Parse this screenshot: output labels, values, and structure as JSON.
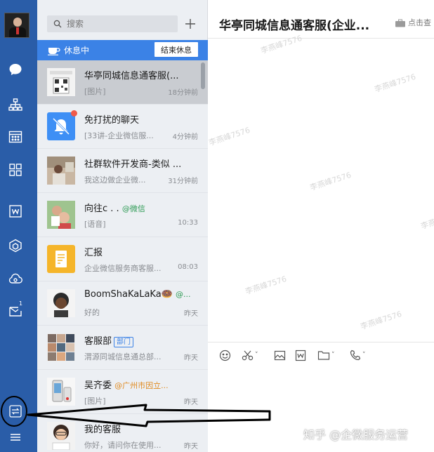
{
  "sidebar": {
    "badge_count": "1"
  },
  "search": {
    "placeholder": "搜索"
  },
  "status_bar": {
    "label": "休息中",
    "end_button": "结束休息"
  },
  "conversations": [
    {
      "name": "华亭同城信息通客服(...",
      "preview": "[图片]",
      "time": "18分钟前",
      "tag": "",
      "active": true
    },
    {
      "name": "免打扰的聊天",
      "preview": "[33讲-企业微信服...",
      "time": "4分钟前",
      "tag": "",
      "active": false
    },
    {
      "name": "社群软件开发商-类似 ...",
      "preview": "我这边做企业微...",
      "time": "31分钟前",
      "tag": "",
      "active": false
    },
    {
      "name": "向往c . .",
      "preview": "[语音]",
      "time": "10:33",
      "tag": "@微信",
      "active": false
    },
    {
      "name": "汇报",
      "preview": "企业微信服务商客服...",
      "time": "08:03",
      "tag": "",
      "active": false
    },
    {
      "name": "BoomShaKaLaKa🍩",
      "preview": "好的",
      "time": "昨天",
      "tag": "@...",
      "active": false
    },
    {
      "name": "客服部",
      "preview": "渭源同城信息通总部...",
      "time": "昨天",
      "tag": "部门",
      "active": false
    },
    {
      "name": "吴齐委",
      "preview": "[图片]",
      "time": "昨天",
      "tag": "@广州市因立...",
      "active": false
    },
    {
      "name": "我的客服",
      "preview": "你好，请问你在使用...",
      "time": "昨天",
      "tag": "",
      "active": false
    }
  ],
  "chat": {
    "title": "华亭同城信息通客服(企业...",
    "header_action": "点击查",
    "watermark": "李燕峰7576"
  },
  "footer_watermark": "知乎 @企微服务运营",
  "colors": {
    "rail": "#2a5da8",
    "accent": "#3b82e6",
    "unread_dot": "#f05a4a"
  }
}
